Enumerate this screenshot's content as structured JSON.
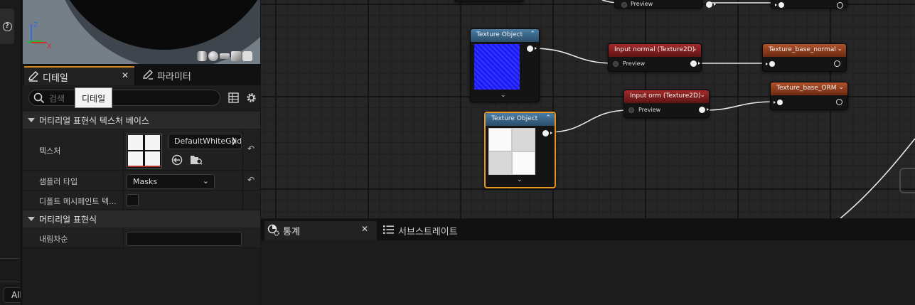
{
  "details_panel": {
    "tab_details": "디테일",
    "tab_parameters": "파라미터",
    "search_placeholder": "검색",
    "tooltip": "디테일",
    "section1_title": "머티리얼 표현식 텍스처 베이스",
    "texture_label": "텍스처",
    "texture_value": "DefaultWhiteGrid",
    "sampler_label": "샘플러 타입",
    "sampler_value": "Masks",
    "default_mesh_label": "디폴트 메시페인트 텍...",
    "section2_title": "머티리얼 표현식",
    "desc_label": "내림차순"
  },
  "left_strip": {
    "help_icon": "?",
    "all_button": "All"
  },
  "viewport": {
    "axis_z": "Z",
    "axis_x": "X",
    "preview_shapes": [
      "cylinder",
      "sphere",
      "plane",
      "cube",
      "teapot"
    ]
  },
  "graph": {
    "node_tex_obj_1": {
      "title": "Texture Object"
    },
    "node_tex_obj_2": {
      "title": "Texture Object"
    },
    "node_input_normal": {
      "title": "Input normal (Texture2D)",
      "pin": "Preview"
    },
    "node_input_orm": {
      "title": "Input orm (Texture2D)",
      "pin": "Preview"
    },
    "node_tex_base_normal": {
      "title": "Texture_base_normal"
    },
    "node_tex_base_orm": {
      "title": "Texture_base_ORM"
    },
    "node_top_preview": {
      "pin": "Preview"
    }
  },
  "bottom_panel": {
    "tab_stats": "통계",
    "tab_substrate": "서브스트레이트"
  },
  "colors": {
    "accent_tab": "#d48a1a",
    "selected_node_border": "#e8961c",
    "header_blue": "#2a4d69",
    "header_red": "#7a1b1b",
    "header_orange": "#8a3a18"
  }
}
